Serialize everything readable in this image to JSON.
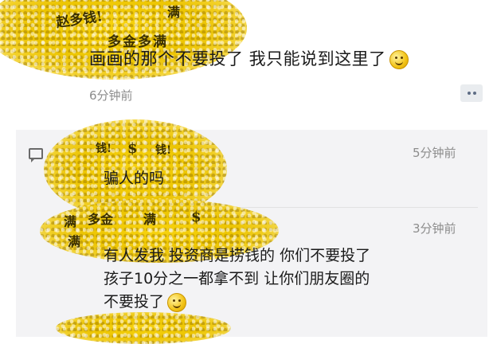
{
  "post": {
    "comment_text": "画画的那个不要投了 我只能说到这里了",
    "time": "6分钟前"
  },
  "doodles": {
    "top_1": "赵多钱!",
    "top_2": "满",
    "top_3": "多金多满",
    "reply_1": "钱!",
    "reply_2": "$",
    "reply_3": "钱!",
    "reply_4": "满",
    "reply_5": "多金",
    "reply_6": "满",
    "reply_7": "$",
    "reply_8": "满"
  },
  "replies": [
    {
      "time": "5分钟前",
      "text": "骗人的吗"
    },
    {
      "time": "3分钟前",
      "lines": [
        "有人发我 投资商是捞钱的 你们不要投了",
        "孩子10分之一都拿不到 让你们朋友圈的",
        "不要投了"
      ]
    }
  ],
  "icons": {
    "more": "more-dots-icon",
    "comment": "comment-bubble-icon",
    "emoji": "smiley-emoji-icon"
  },
  "colors": {
    "glitter": "#e8c414",
    "panel": "#f3f3f5",
    "time": "#8c8c8c",
    "more_btn": "#e9ecef"
  }
}
